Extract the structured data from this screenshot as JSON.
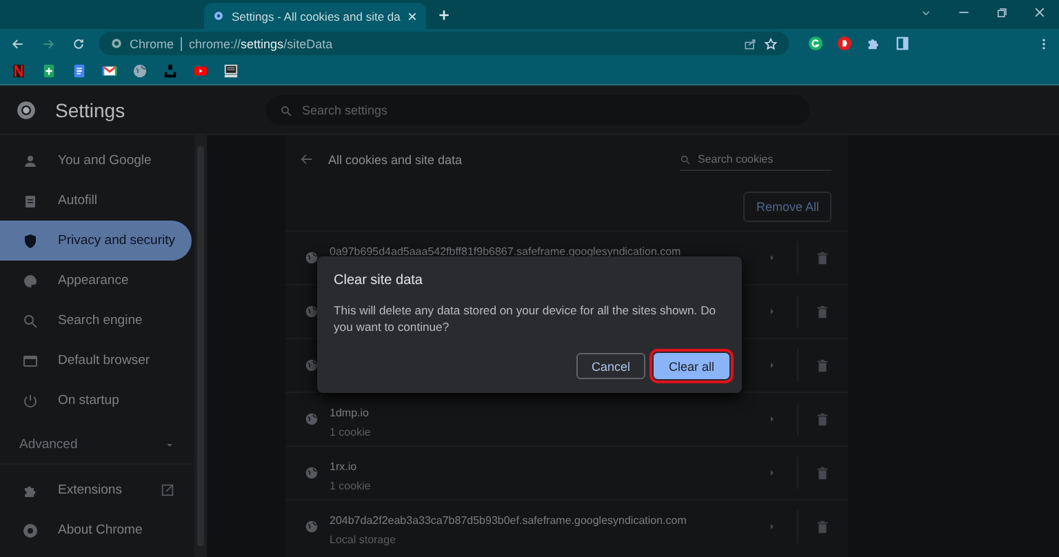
{
  "tab": {
    "title": "Settings - All cookies and site da"
  },
  "address_bar": {
    "origin_label": "Chrome",
    "url": "chrome://**settings**/siteData"
  },
  "settings_header": {
    "title": "Settings",
    "search_placeholder": "Search settings"
  },
  "sidebar": {
    "items": [
      {
        "label": "You and Google",
        "selected": false
      },
      {
        "label": "Autofill",
        "selected": false
      },
      {
        "label": "Privacy and security",
        "selected": true
      },
      {
        "label": "Appearance",
        "selected": false
      },
      {
        "label": "Search engine",
        "selected": false
      },
      {
        "label": "Default browser",
        "selected": false
      },
      {
        "label": "On startup",
        "selected": false
      }
    ],
    "advanced": {
      "label": "Advanced",
      "expanded": false
    },
    "footer_items": [
      {
        "label": "Extensions",
        "external": true
      },
      {
        "label": "About Chrome",
        "external": false
      }
    ]
  },
  "page": {
    "title": "All cookies and site data",
    "search_placeholder": "Search cookies",
    "remove_all": "Remove All",
    "rows": [
      {
        "host": "0a97b695d4ad5aaa542fbff81f9b6867.safeframe.googlesyndication.com"
      },
      {},
      {},
      {
        "host": "1dmp.io",
        "detail": "1 cookie"
      },
      {
        "host": "1rx.io",
        "detail": "1 cookie"
      },
      {
        "host": "204b7da2f2eab3a33ca7b87d5b93b0ef.safeframe.googlesyndication.com",
        "detail": "Local storage"
      }
    ]
  },
  "dialog": {
    "title": "Clear site data",
    "message": "This will delete any data stored on your device for all the sites shown. Do you want to continue?",
    "buttons": [
      {
        "label": "Cancel",
        "kind": "secondary",
        "highlighted": false
      },
      {
        "label": "Clear all",
        "kind": "primary",
        "highlighted": true
      }
    ]
  }
}
